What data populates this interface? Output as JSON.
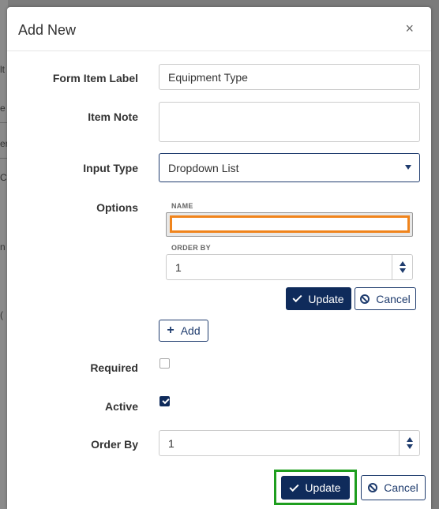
{
  "dialog": {
    "title": "Add New",
    "close_glyph": "×"
  },
  "background": {
    "fragments": [
      "lt",
      "e",
      "er",
      "C",
      "n",
      "("
    ]
  },
  "form": {
    "form_item_label": {
      "label": "Form Item Label",
      "value": "Equipment Type"
    },
    "item_note": {
      "label": "Item Note",
      "value": ""
    },
    "input_type": {
      "label": "Input Type",
      "value": "Dropdown List"
    },
    "options": {
      "label": "Options",
      "name_label": "NAME",
      "name_value": "",
      "order_by_label": "ORDER BY",
      "order_by_value": "1",
      "update_label": "Update",
      "cancel_label": "Cancel",
      "add_label": "Add"
    },
    "required": {
      "label": "Required",
      "checked": false
    },
    "active": {
      "label": "Active",
      "checked": true
    },
    "order_by": {
      "label": "Order By",
      "value": "1"
    }
  },
  "footer": {
    "update_label": "Update",
    "cancel_label": "Cancel"
  },
  "colors": {
    "primary": "#0f2b5b",
    "highlight_orange": "#f0841c",
    "highlight_green": "#1e9e1e"
  }
}
